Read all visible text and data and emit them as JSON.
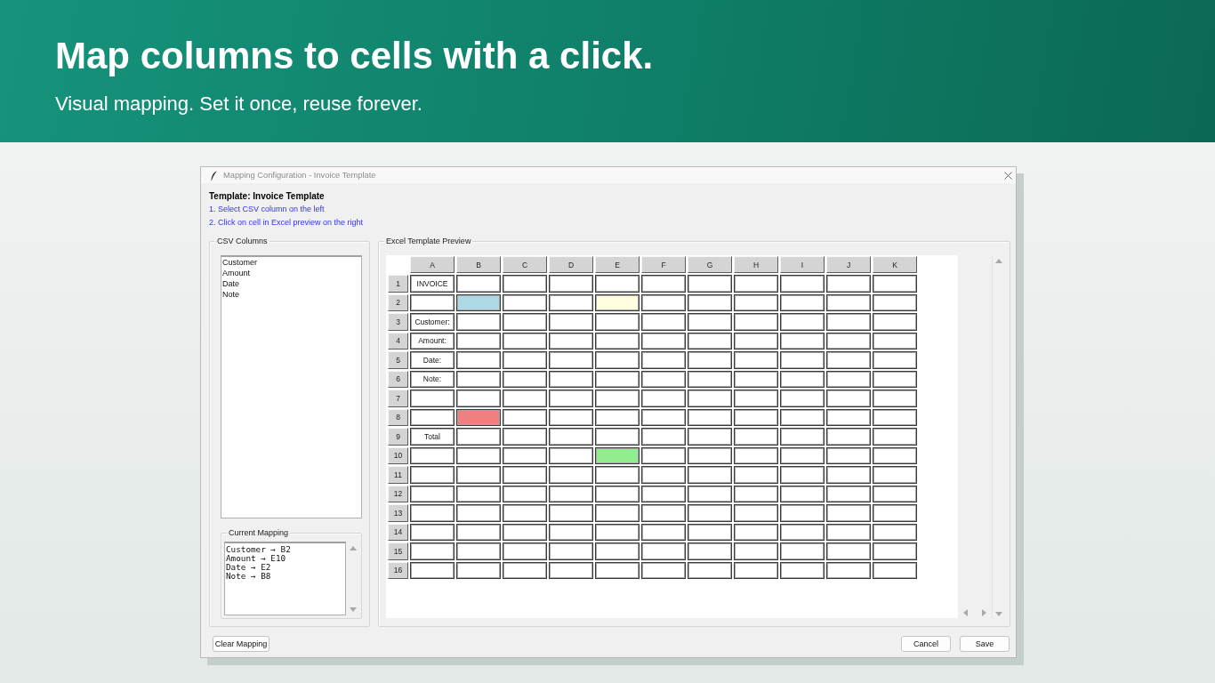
{
  "banner": {
    "headline": "Map columns to cells with a click.",
    "subtitle": "Visual mapping. Set it once, reuse forever."
  },
  "window": {
    "title": "Mapping Configuration - Invoice Template"
  },
  "template_label": "Template: Invoice Template",
  "instructions": [
    "1. Select CSV column on the left",
    "2. Click on cell in Excel preview on the right"
  ],
  "csv_panel": {
    "title": "CSV Columns",
    "columns": [
      {
        "label": "Customer",
        "selected": false
      },
      {
        "label": "Amount",
        "selected": false
      },
      {
        "label": "Date",
        "selected": false
      },
      {
        "label": "Note",
        "selected": false
      }
    ]
  },
  "mapping_panel": {
    "title": "Current Mapping",
    "lines": [
      "Customer → B2",
      "Amount → E10",
      "Date → E2",
      "Note → B8"
    ]
  },
  "preview": {
    "title": "Excel Template Preview",
    "column_headers": [
      "A",
      "B",
      "C",
      "D",
      "E",
      "F",
      "G",
      "H",
      "I",
      "J",
      "K"
    ],
    "rows": [
      {
        "label": "1",
        "cells": [
          {
            "text": "INVOICE"
          },
          {},
          {},
          {},
          {},
          {},
          {},
          {},
          {},
          {},
          {}
        ]
      },
      {
        "label": "2",
        "cells": [
          {},
          {
            "color": "#add8e6"
          },
          {},
          {},
          {
            "color": "#ffffe0"
          },
          {},
          {},
          {},
          {},
          {},
          {}
        ]
      },
      {
        "label": "3",
        "cells": [
          {
            "text": "Customer:"
          },
          {},
          {},
          {},
          {},
          {},
          {},
          {},
          {},
          {},
          {}
        ]
      },
      {
        "label": "4",
        "cells": [
          {
            "text": "Amount:"
          },
          {},
          {},
          {},
          {},
          {},
          {},
          {},
          {},
          {},
          {}
        ]
      },
      {
        "label": "5",
        "cells": [
          {
            "text": "Date:"
          },
          {},
          {},
          {},
          {},
          {},
          {},
          {},
          {},
          {},
          {}
        ]
      },
      {
        "label": "6",
        "cells": [
          {
            "text": "Note:"
          },
          {},
          {},
          {},
          {},
          {},
          {},
          {},
          {},
          {},
          {}
        ]
      },
      {
        "label": "7",
        "cells": [
          {},
          {},
          {},
          {},
          {},
          {},
          {},
          {},
          {},
          {},
          {}
        ]
      },
      {
        "label": "8",
        "cells": [
          {},
          {
            "color": "#f08080"
          },
          {},
          {},
          {},
          {},
          {},
          {},
          {},
          {},
          {}
        ]
      },
      {
        "label": "9",
        "cells": [
          {
            "text": "Total"
          },
          {},
          {},
          {},
          {},
          {},
          {},
          {},
          {},
          {},
          {}
        ]
      },
      {
        "label": "10",
        "cells": [
          {},
          {},
          {},
          {},
          {
            "color": "#90ee90"
          },
          {},
          {},
          {},
          {},
          {},
          {}
        ]
      },
      {
        "label": "11",
        "cells": [
          {},
          {},
          {},
          {},
          {},
          {},
          {},
          {},
          {},
          {},
          {}
        ]
      },
      {
        "label": "12",
        "cells": [
          {},
          {},
          {},
          {},
          {},
          {},
          {},
          {},
          {},
          {},
          {}
        ]
      },
      {
        "label": "13",
        "cells": [
          {},
          {},
          {},
          {},
          {},
          {},
          {},
          {},
          {},
          {},
          {}
        ]
      },
      {
        "label": "14",
        "cells": [
          {},
          {},
          {},
          {},
          {},
          {},
          {},
          {},
          {},
          {},
          {}
        ]
      },
      {
        "label": "15",
        "cells": [
          {},
          {},
          {},
          {},
          {},
          {},
          {},
          {},
          {},
          {},
          {}
        ]
      },
      {
        "label": "16",
        "cells": [
          {},
          {},
          {},
          {},
          {},
          {},
          {},
          {},
          {},
          {},
          {}
        ]
      }
    ]
  },
  "footer": {
    "clear_button": "Clear Mapping",
    "cancel_button": "Cancel",
    "save_button": "Save"
  }
}
